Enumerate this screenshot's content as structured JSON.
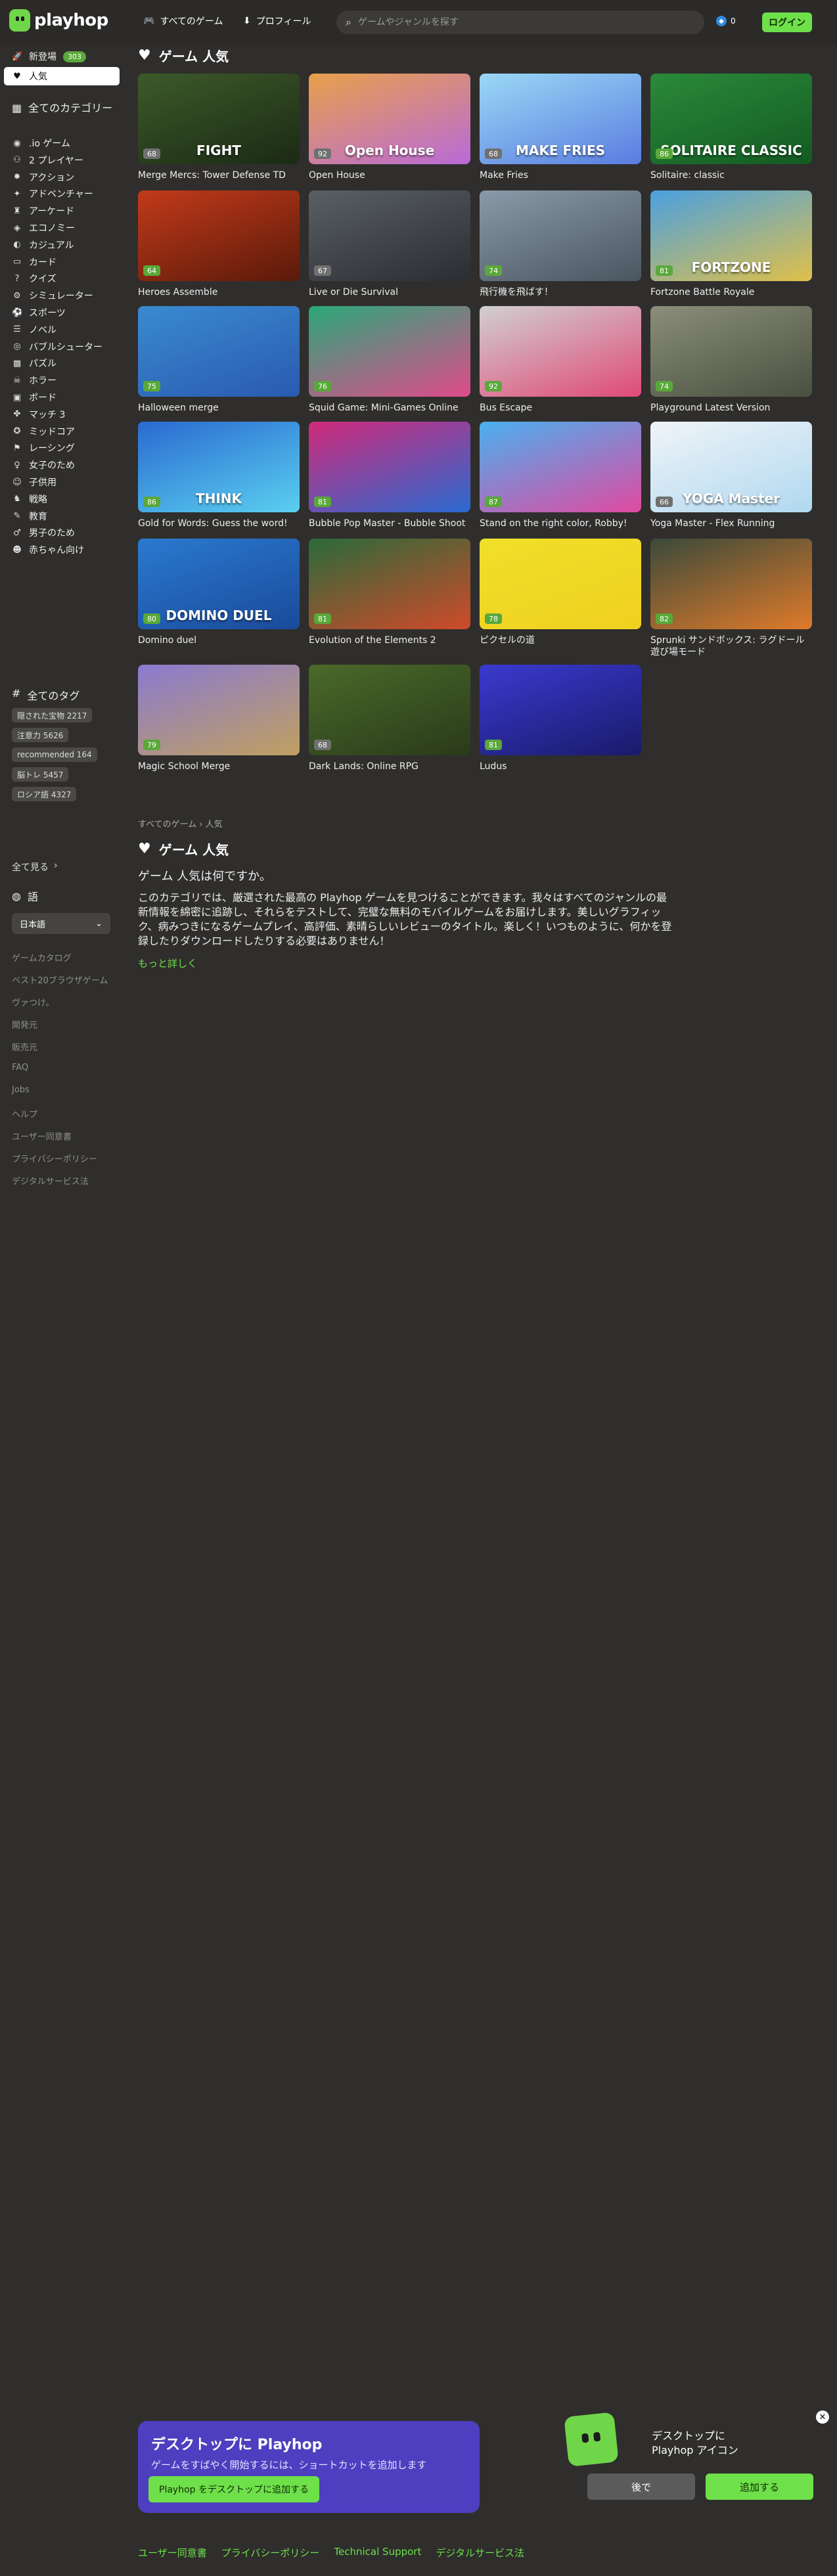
{
  "header": {
    "brand": "playhop",
    "all_games": "すべてのゲーム",
    "profile": "プロフィール",
    "search_placeholder": "ゲームやジャンルを探す",
    "coins": "0",
    "login": "ログイン"
  },
  "sidebar": {
    "new_label": "新登場",
    "new_count": "303",
    "popular_label": "人気",
    "all_categories": "全てのカテゴリー",
    "categories": [
      ".io ゲーム",
      "2 プレイヤー",
      "アクション",
      "アドベンチャー",
      "アーケード",
      "エコノミー",
      "カジュアル",
      "カード",
      "クイズ",
      "シミュレーター",
      "スポーツ",
      "ノベル",
      "バブルシューター",
      "パズル",
      "ホラー",
      "ボード",
      "マッチ 3",
      "ミッドコア",
      "レーシング",
      "女子のため",
      "子供用",
      "戦略",
      "教育",
      "男子のため",
      "赤ちゃん向け"
    ],
    "all_tags": "全てのタグ",
    "tags": [
      "隠された宝物 2217",
      "注意力 5626",
      "recommended 164",
      "脳トレ 5457",
      "ロシア語 4327"
    ],
    "see_all": "全て見る",
    "language_head": "語",
    "language_value": "日本語",
    "footer_links": [
      "ゲームカタログ",
      "ベスト20ブラウザゲーム",
      "ヴァつけ。",
      "開発元",
      "販売元",
      "FAQ",
      "Jobs",
      "ヘルプ",
      "ユーザー同意書",
      "プライバシーポリシー",
      "デジタルサービス法"
    ]
  },
  "main": {
    "title": "ゲーム 人気",
    "games": [
      {
        "title": "Merge Mercs: Tower Defense TD",
        "rating": "68",
        "art": "FIGHT",
        "color1": "#3d5a2a",
        "color2": "#1b2a14"
      },
      {
        "title": "Open House",
        "rating": "92",
        "art": "Open House",
        "color1": "#e8a04a",
        "color2": "#b96ad9"
      },
      {
        "title": "Make Fries",
        "rating": "68",
        "art": "MAKE FRIES",
        "color1": "#9ad8f5",
        "color2": "#5a7ce0"
      },
      {
        "title": "Solitaire: classic",
        "rating": "86",
        "art": "SOLITAIRE CLASSIC",
        "color1": "#2a8a3a",
        "color2": "#145a22"
      },
      {
        "title": "Heroes Assemble",
        "rating": "64",
        "art": "",
        "color1": "#c23a1a",
        "color2": "#5a1a0a"
      },
      {
        "title": "Live or Die Survival",
        "rating": "67",
        "art": "",
        "color1": "#5a5f66",
        "color2": "#2a2d32"
      },
      {
        "title": "飛行機を飛ばす！",
        "rating": "74",
        "art": "",
        "color1": "#8a9aa8",
        "color2": "#4a5560"
      },
      {
        "title": "Fortzone Battle Royale",
        "rating": "81",
        "art": "FORTZONE",
        "color1": "#4aa0e0",
        "color2": "#e0c04a"
      },
      {
        "title": "Halloween merge",
        "rating": "75",
        "art": "",
        "color1": "#3a8ad0",
        "color2": "#2a5ab0"
      },
      {
        "title": "Squid Game: Mini-Games Online",
        "rating": "76",
        "art": "",
        "color1": "#2aa87a",
        "color2": "#e04a8a"
      },
      {
        "title": "Bus Escape",
        "rating": "92",
        "art": "",
        "color1": "#d0d0d0",
        "color2": "#e04a7a"
      },
      {
        "title": "Playground Latest Version",
        "rating": "74",
        "art": "",
        "color1": "#8a8e7a",
        "color2": "#4a5040"
      },
      {
        "title": "Gold for Words: Guess the word!",
        "rating": "86",
        "art": "THINK",
        "color1": "#2a6ad0",
        "color2": "#5ad0f0"
      },
      {
        "title": "Bubble Pop Master - Bubble Shoot",
        "rating": "81",
        "art": "",
        "color1": "#d02a7a",
        "color2": "#2a6ad0"
      },
      {
        "title": "Stand on the right color, Robby!",
        "rating": "87",
        "art": "",
        "color1": "#4ab0f0",
        "color2": "#e04aa0"
      },
      {
        "title": "Yoga Master - Flex Running",
        "rating": "66",
        "art": "YOGA Master",
        "color1": "#f0f4f8",
        "color2": "#b0d8f0"
      },
      {
        "title": "Domino duel",
        "rating": "80",
        "art": "DOMINO DUEL",
        "color1": "#2a7ad0",
        "color2": "#1a4a9a"
      },
      {
        "title": "Evolution of the Elements 2",
        "rating": "81",
        "art": "",
        "color1": "#2a6a3a",
        "color2": "#d04a2a"
      },
      {
        "title": "ピクセルの道",
        "rating": "78",
        "art": "",
        "color1": "#f0e02a",
        "color2": "#f0d020"
      },
      {
        "title": "Sprunki サンドボックス: ラグドール遊び場モード",
        "rating": "82",
        "art": "",
        "color1": "#3a4a3a",
        "color2": "#e07a2a"
      },
      {
        "title": "Magic School Merge",
        "rating": "79",
        "art": "",
        "color1": "#8a7ad0",
        "color2": "#c0a060"
      },
      {
        "title": "Dark Lands: Online RPG",
        "rating": "68",
        "art": "",
        "color1": "#4a6a2a",
        "color2": "#2a3a1a"
      },
      {
        "title": "Ludus",
        "rating": "81",
        "art": "",
        "color1": "#3a3ad0",
        "color2": "#1a1a6a"
      }
    ],
    "breadcrumb": "すべてのゲーム › 人気",
    "seo_title": "ゲーム 人気",
    "seo_question": "ゲーム 人気は何ですか。",
    "seo_body": "このカテゴリでは、厳選された最高の Playhop ゲームを見つけることができます。我々はすべてのジャンルの最新情報を綿密に追跡し、それらをテストして、完璧な無料のモバイルゲームをお届けします。美しいグラフィック、病みつきになるゲームプレイ、高評価、素晴らしいレビューのタイトル。楽しく！いつものように、何かを登録したりダウンロードしたりする必要はありません！",
    "more": "もっと詳しく"
  },
  "promo": {
    "title": "デスクトップに Playhop",
    "text": "ゲームをすばやく開始するには、ショートカットを追加します",
    "button": "Playhop をデスクトップに追加する"
  },
  "popup": {
    "text": "デスクトップに Playhop アイコン",
    "later": "後で",
    "add": "追加する"
  },
  "footer": {
    "links": [
      "ユーザー同意書",
      "プライバシーポリシー",
      "Technical Support",
      "デジタルサービス法"
    ]
  }
}
